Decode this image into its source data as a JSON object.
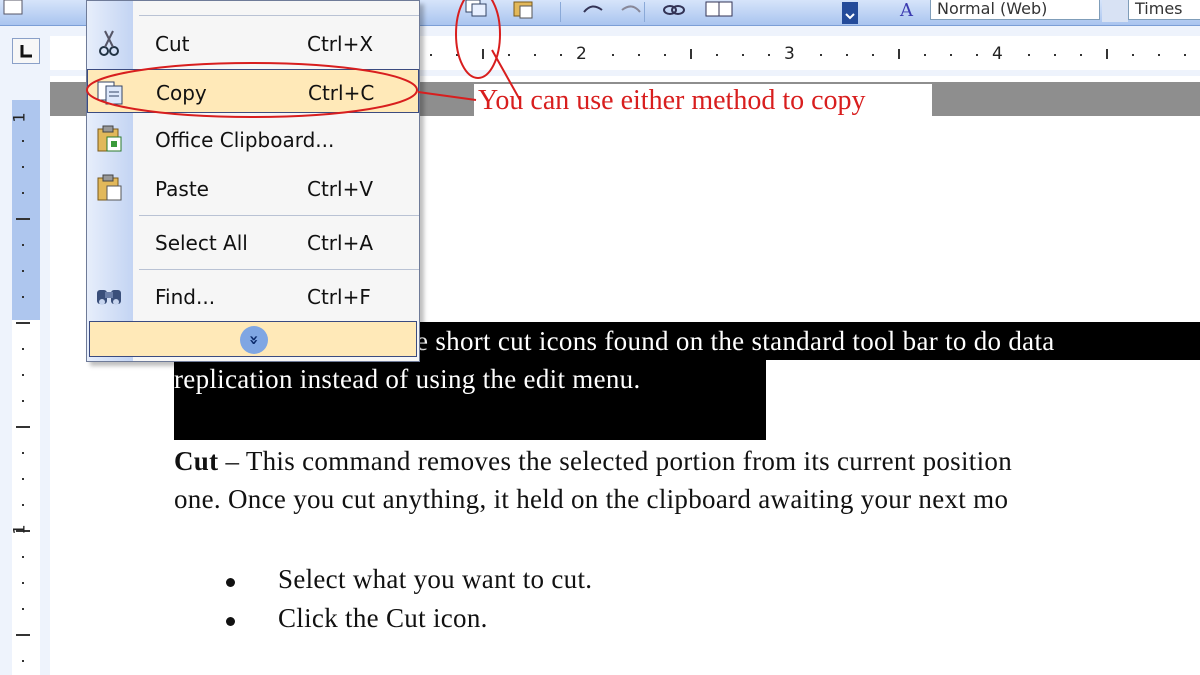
{
  "toolbar": {
    "style_value": "Normal (Web)",
    "font_value": "Times"
  },
  "ruler": {
    "numbers": [
      "2",
      "3",
      "4"
    ]
  },
  "vertical_ruler": {
    "numbers": [
      "1",
      "1"
    ]
  },
  "menu": {
    "items": [
      {
        "label": "Cut",
        "shortcut": "Ctrl+X",
        "icon": "scissors-icon"
      },
      {
        "label": "Copy",
        "shortcut": "Ctrl+C",
        "icon": "copy-icon",
        "highlighted": true
      },
      {
        "label": "Office Clipboard...",
        "shortcut": "",
        "icon": "clipboard-icon"
      },
      {
        "label": "Paste",
        "shortcut": "Ctrl+V",
        "icon": "paste-icon"
      },
      {
        "label": "Select All",
        "shortcut": "Ctrl+A",
        "icon": ""
      },
      {
        "label": "Find...",
        "shortcut": "Ctrl+F",
        "icon": "binoculars-icon"
      }
    ],
    "expand_glyph": "»"
  },
  "annotation": {
    "text": "You can use either method to copy",
    "color": "#d81e1e"
  },
  "document": {
    "selected_line1": "e short cut icons found on the standard tool bar to do data",
    "selected_line2": "replication instead of using the edit menu.",
    "cut_bold": "Cut",
    "cut_line1_rest": " – This command removes the selected portion from its current position",
    "cut_line2": "one. Once you cut anything, it held on the clipboard awaiting your next mo",
    "bullets": [
      "Select what you want to cut.",
      "Click the Cut icon."
    ]
  },
  "colors": {
    "menu_highlight": "#ffe9b8",
    "selection": "#000000",
    "toolbar": "#a9c4ef"
  }
}
